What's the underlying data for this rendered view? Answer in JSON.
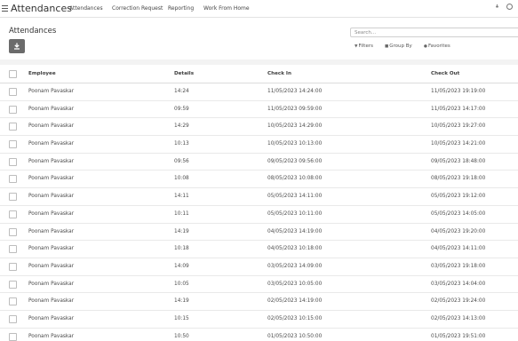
{
  "app": {
    "title": "Attendances"
  },
  "nav": {
    "items": [
      {
        "label": "Attendances"
      },
      {
        "label": "Correction Request"
      },
      {
        "label": "Reporting"
      },
      {
        "label": "Work From Home"
      }
    ]
  },
  "control": {
    "page_title": "Attendances",
    "search_placeholder": "Search...",
    "filters_label": "Filters",
    "group_by_label": "Group By",
    "favorites_label": "Favorites"
  },
  "table": {
    "headers": {
      "employee": "Employee",
      "details": "Details",
      "check_in": "Check In",
      "check_out": "Check Out"
    },
    "rows": [
      {
        "employee": "Poonam Pavaskar",
        "details": "14:24",
        "check_in": "11/05/2023 14:24:00",
        "check_out": "11/05/2023 19:19:00"
      },
      {
        "employee": "Poonam Pavaskar",
        "details": "09:59",
        "check_in": "11/05/2023 09:59:00",
        "check_out": "11/05/2023 14:17:00"
      },
      {
        "employee": "Poonam Pavaskar",
        "details": "14:29",
        "check_in": "10/05/2023 14:29:00",
        "check_out": "10/05/2023 19:27:00"
      },
      {
        "employee": "Poonam Pavaskar",
        "details": "10:13",
        "check_in": "10/05/2023 10:13:00",
        "check_out": "10/05/2023 14:21:00"
      },
      {
        "employee": "Poonam Pavaskar",
        "details": "09:56",
        "check_in": "09/05/2023 09:56:00",
        "check_out": "09/05/2023 18:48:00"
      },
      {
        "employee": "Poonam Pavaskar",
        "details": "10:08",
        "check_in": "08/05/2023 10:08:00",
        "check_out": "08/05/2023 19:18:00"
      },
      {
        "employee": "Poonam Pavaskar",
        "details": "14:11",
        "check_in": "05/05/2023 14:11:00",
        "check_out": "05/05/2023 19:12:00"
      },
      {
        "employee": "Poonam Pavaskar",
        "details": "10:11",
        "check_in": "05/05/2023 10:11:00",
        "check_out": "05/05/2023 14:05:00"
      },
      {
        "employee": "Poonam Pavaskar",
        "details": "14:19",
        "check_in": "04/05/2023 14:19:00",
        "check_out": "04/05/2023 19:20:00"
      },
      {
        "employee": "Poonam Pavaskar",
        "details": "10:18",
        "check_in": "04/05/2023 10:18:00",
        "check_out": "04/05/2023 14:11:00"
      },
      {
        "employee": "Poonam Pavaskar",
        "details": "14:09",
        "check_in": "03/05/2023 14:09:00",
        "check_out": "03/05/2023 19:18:00"
      },
      {
        "employee": "Poonam Pavaskar",
        "details": "10:05",
        "check_in": "03/05/2023 10:05:00",
        "check_out": "03/05/2023 14:04:00"
      },
      {
        "employee": "Poonam Pavaskar",
        "details": "14:19",
        "check_in": "02/05/2023 14:19:00",
        "check_out": "02/05/2023 19:24:00"
      },
      {
        "employee": "Poonam Pavaskar",
        "details": "10:15",
        "check_in": "02/05/2023 10:15:00",
        "check_out": "02/05/2023 14:13:00"
      },
      {
        "employee": "Poonam Pavaskar",
        "details": "10:50",
        "check_in": "01/05/2023 10:50:00",
        "check_out": "01/05/2023 19:51:00"
      }
    ]
  }
}
